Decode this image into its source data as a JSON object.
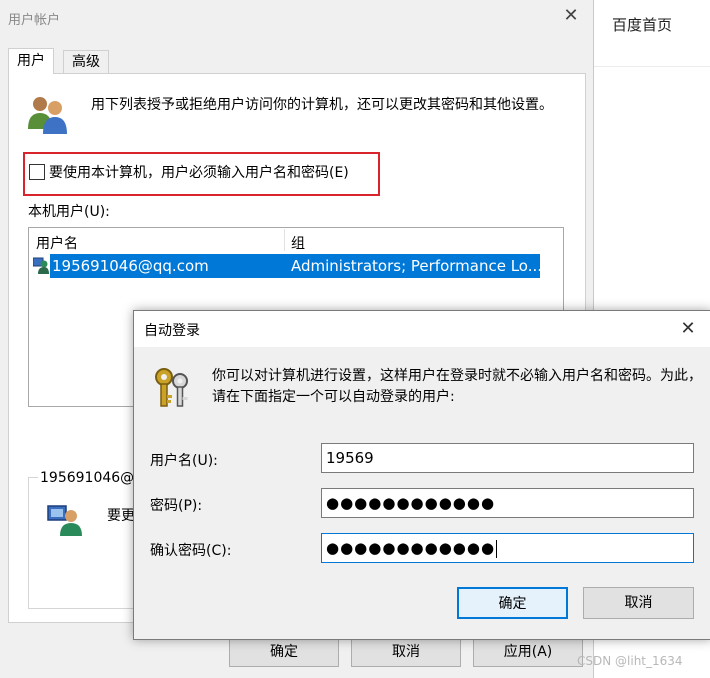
{
  "background_app": {
    "link": "百度首页"
  },
  "main_dialog": {
    "title": "用户帐户",
    "tabs": [
      {
        "label": "用户",
        "active": true
      },
      {
        "label": "高级",
        "active": false
      }
    ],
    "intro": "用下列表授予或拒绝用户访问你的计算机，还可以更改其密码和其他设置。",
    "require_checkbox": {
      "label": "要使用本计算机，用户必须输入用户名和密码(E)",
      "checked": false
    },
    "local_users_label": "本机用户(U):",
    "columns": [
      "用户名",
      "组"
    ],
    "rows": [
      {
        "user": "195691046@qq.com",
        "group": "Administrators; Performance Lo...",
        "selected": true
      }
    ],
    "detail_user": "195691046@",
    "detail_text": "要更",
    "buttons": {
      "ok": "确定",
      "cancel": "取消",
      "apply": "应用(A)"
    }
  },
  "auto_logon_dialog": {
    "title": "自动登录",
    "description": "你可以对计算机进行设置，这样用户在登录时就不必输入用户名和密码。为此，请在下面指定一个可以自动登录的用户:",
    "fields": {
      "username": {
        "label": "用户名(U):",
        "value": "19569"
      },
      "password": {
        "label": "密码(P):",
        "value": "●●●●●●●●●●●●"
      },
      "confirm": {
        "label": "确认密码(C):",
        "value": "●●●●●●●●●●●●"
      }
    },
    "buttons": {
      "ok": "确定",
      "cancel": "取消"
    }
  },
  "watermark": "CSDN @liht_1634",
  "colors": {
    "selection": "#0078d7",
    "highlight_box": "#d9232d",
    "dialog_bg": "#f0f0f0"
  },
  "icons": [
    "users-icon",
    "user-row-icon",
    "user-detail-icon",
    "keys-icon",
    "close-icon"
  ]
}
